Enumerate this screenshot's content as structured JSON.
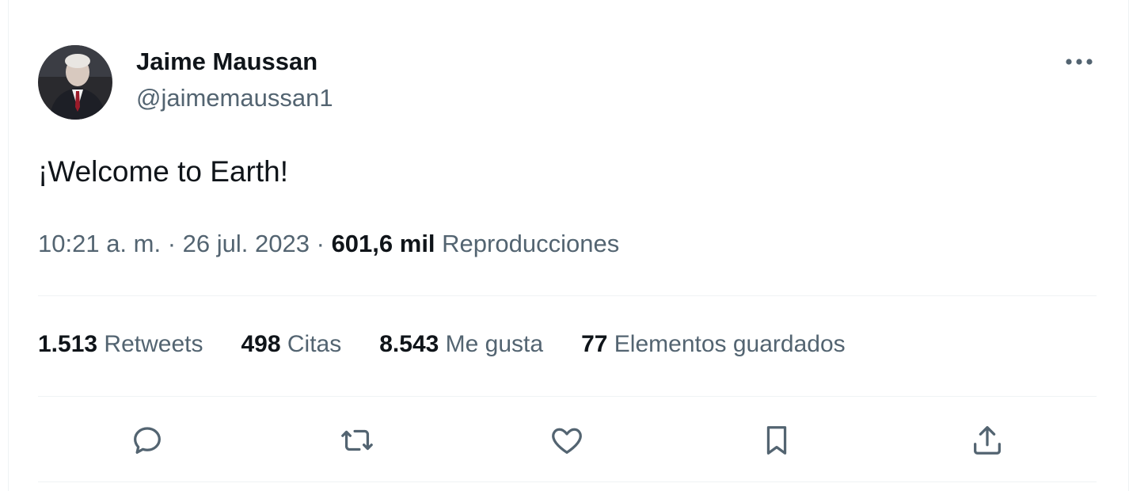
{
  "user": {
    "name": "Jaime Maussan",
    "handle": "@jaimemaussan1",
    "avatar_icon": "avatar-photo"
  },
  "tweet": {
    "text": "¡Welcome to Earth!"
  },
  "meta": {
    "time": "10:21 a. m.",
    "separator": "·",
    "date": "26 jul. 2023",
    "views_count": "601,6 mil",
    "views_label": "Reproducciones"
  },
  "stats": {
    "retweets_count": "1.513",
    "retweets_label": "Retweets",
    "quotes_count": "498",
    "quotes_label": "Citas",
    "likes_count": "8.543",
    "likes_label": "Me gusta",
    "bookmarks_count": "77",
    "bookmarks_label": "Elementos guardados"
  },
  "actions": [
    {
      "icon": "reply-icon"
    },
    {
      "icon": "retweet-icon"
    },
    {
      "icon": "like-icon"
    },
    {
      "icon": "bookmark-icon"
    },
    {
      "icon": "share-icon"
    }
  ],
  "colors": {
    "primary_text": "#0f1419",
    "secondary_text": "#536471",
    "divider": "#eff3f4"
  }
}
